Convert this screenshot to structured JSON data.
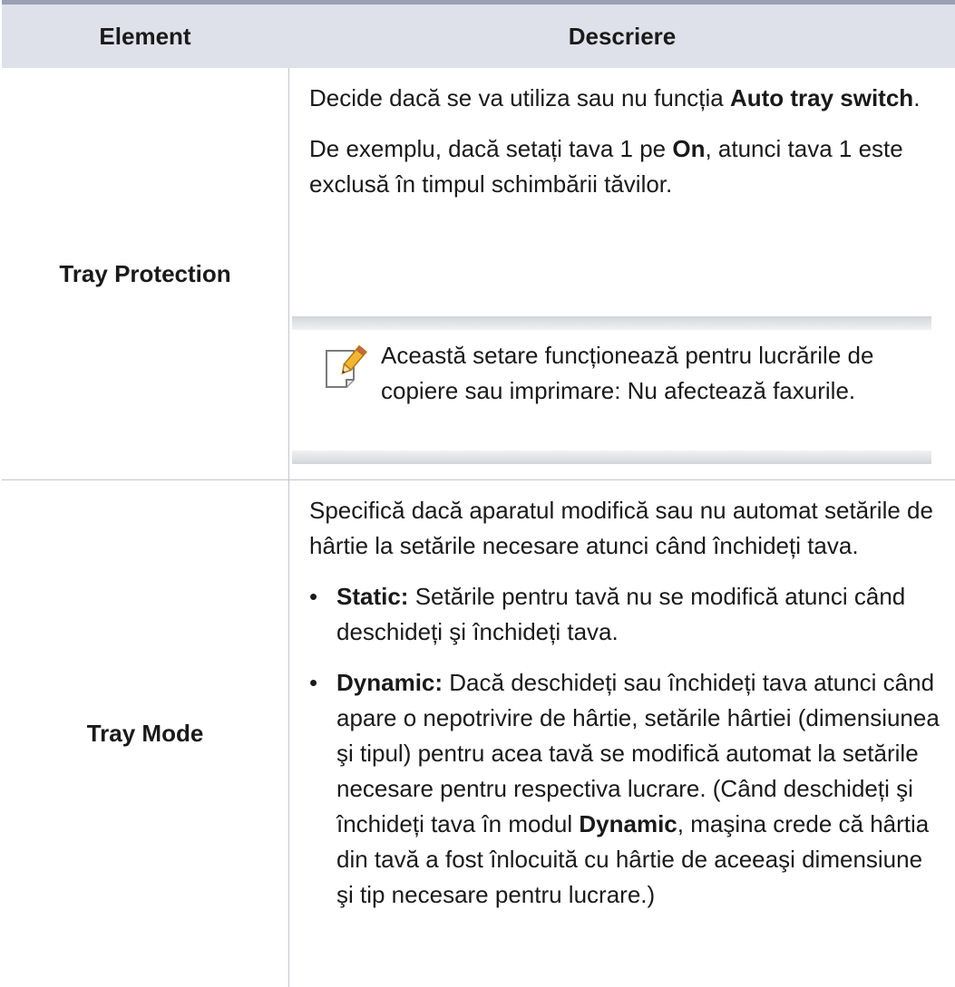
{
  "header": {
    "col_element": "Element",
    "col_description": "Descriere"
  },
  "rows": [
    {
      "element": "Tray Protection",
      "p1_text1": "Decide dacă se va utiliza sau nu funcția ",
      "p1_bold": "Auto tray switch",
      "p1_text2": ".",
      "p2_text1": "De exemplu, dacă setați tava 1 pe ",
      "p2_bold": "On",
      "p2_text2": ", atunci tava 1 este exclusă în timpul schimbării tăvilor.",
      "note_icon": "note-pencil-icon",
      "note_text": "Această setare funcționează pentru lucrările de copiere sau imprimare: Nu afectează faxurile."
    },
    {
      "element": "Tray Mode",
      "intro": "Specifică dacă aparatul modifică sau nu automat setările de hârtie la setările necesare atunci când închideți tava.",
      "bullet_glyph": "•",
      "bullet1_bold": "Static:",
      "bullet1_text": " Setările pentru tavă nu se modifică atunci când deschideți şi închideți tava.",
      "bullet2_bold": "Dynamic:",
      "bullet2_text1": " Dacă deschideți sau închideți tava atunci când apare o nepotrivire de hârtie, setările hârtiei (dimensiunea şi tipul) pentru acea tavă se modifică automat la setările necesare pentru respectiva lucrare. (Când deschideți şi închideți tava în modul ",
      "bullet2_bold2": "Dynamic",
      "bullet2_text2": ", maşina crede că hârtia din tavă a fost înlocuită cu hârtie de aceeaşi dimensiune şi tip necesare pentru lucrare.)"
    }
  ]
}
